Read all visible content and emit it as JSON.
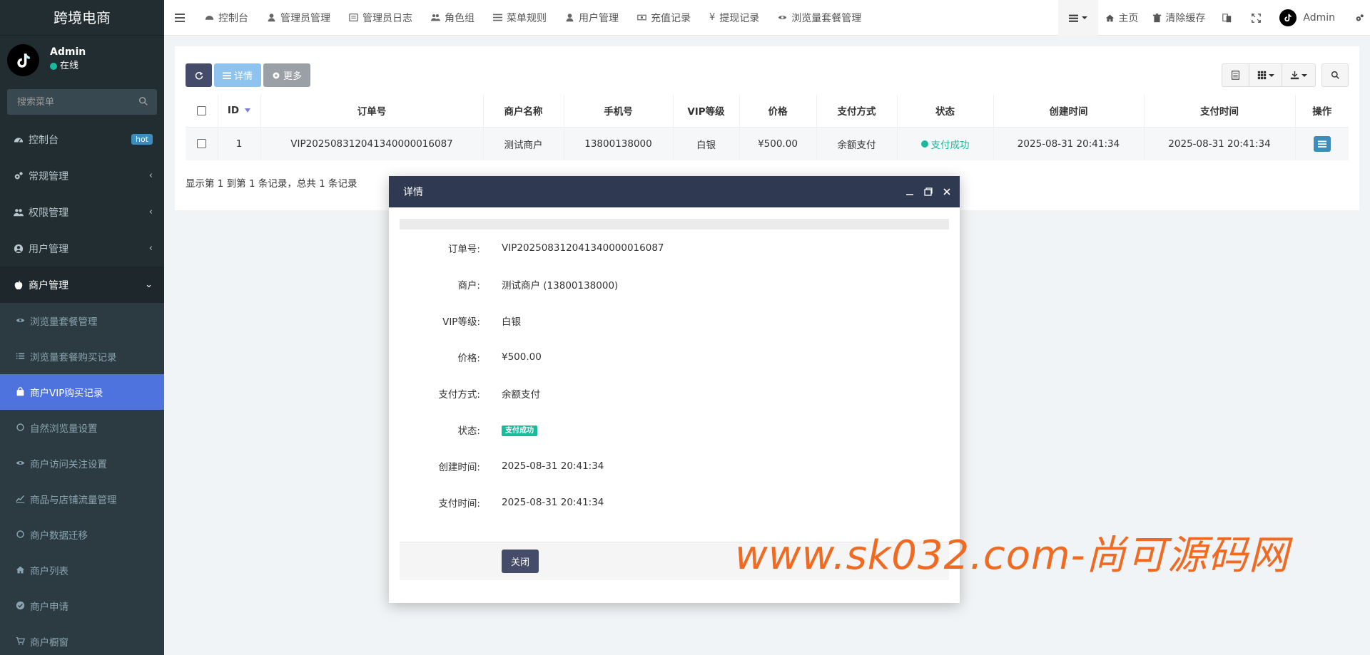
{
  "sidebar": {
    "brand": "跨境电商",
    "user": {
      "name": "Admin",
      "status": "在线"
    },
    "search_placeholder": "搜索菜单",
    "items": [
      {
        "label": "控制台",
        "badge": "hot"
      },
      {
        "label": "常规管理"
      },
      {
        "label": "权限管理"
      },
      {
        "label": "用户管理"
      },
      {
        "label": "商户管理"
      }
    ],
    "subitems": [
      {
        "label": "浏览量套餐管理"
      },
      {
        "label": "浏览量套餐购买记录"
      },
      {
        "label": "商户VIP购买记录"
      },
      {
        "label": "自然浏览量设置"
      },
      {
        "label": "商户访问关注设置"
      },
      {
        "label": "商品与店铺流量管理"
      },
      {
        "label": "商户数据迁移"
      },
      {
        "label": "商户列表"
      },
      {
        "label": "商户申请"
      },
      {
        "label": "商户橱窗"
      }
    ]
  },
  "navbar": {
    "tabs": [
      "控制台",
      "管理员管理",
      "管理员日志",
      "角色组",
      "菜单规则",
      "用户管理",
      "充值记录",
      "提现记录",
      "浏览量套餐管理"
    ],
    "right": {
      "home": "主页",
      "clear_cache": "清除缓存",
      "admin": "Admin"
    }
  },
  "toolbar": {
    "detail": "详情",
    "more": "更多"
  },
  "table": {
    "headers": [
      "ID",
      "订单号",
      "商户名称",
      "手机号",
      "VIP等级",
      "价格",
      "支付方式",
      "状态",
      "创建时间",
      "支付时间",
      "操作"
    ],
    "rows": [
      {
        "id": "1",
        "order_no": "VIP20250831204134000001 6087",
        "merchant": "测试商户",
        "phone": "13800138000",
        "vip": "白银",
        "price": "¥500.00",
        "pay_method": "余额支付",
        "status": "支付成功",
        "created": "2025-08-31 20:41:34",
        "paid": "2025-08-31 20:41:34"
      }
    ],
    "summary": "显示第 1 到第 1 条记录，总共 1 条记录"
  },
  "modal": {
    "title": "详情",
    "fields": [
      {
        "label": "订单号:",
        "value": "VIP202508312041340000016087"
      },
      {
        "label": "商户:",
        "value": "测试商户 (13800138000)"
      },
      {
        "label": "VIP等级:",
        "value": "白银"
      },
      {
        "label": "价格:",
        "value": "¥500.00"
      },
      {
        "label": "支付方式:",
        "value": "余额支付"
      },
      {
        "label": "状态:",
        "value": "支付成功"
      },
      {
        "label": "创建时间:",
        "value": "2025-08-31 20:41:34"
      },
      {
        "label": "支付时间:",
        "value": "2025-08-31 20:41:34"
      }
    ],
    "close_label": "关闭"
  },
  "watermark": "www.sk032.com-尚可源码网",
  "colors": {
    "sidebar_bg": "#222d32",
    "active_item": "#4e73df",
    "success": "#18bc9c",
    "modal_head": "#2f3a52",
    "watermark": "#f06a22"
  }
}
